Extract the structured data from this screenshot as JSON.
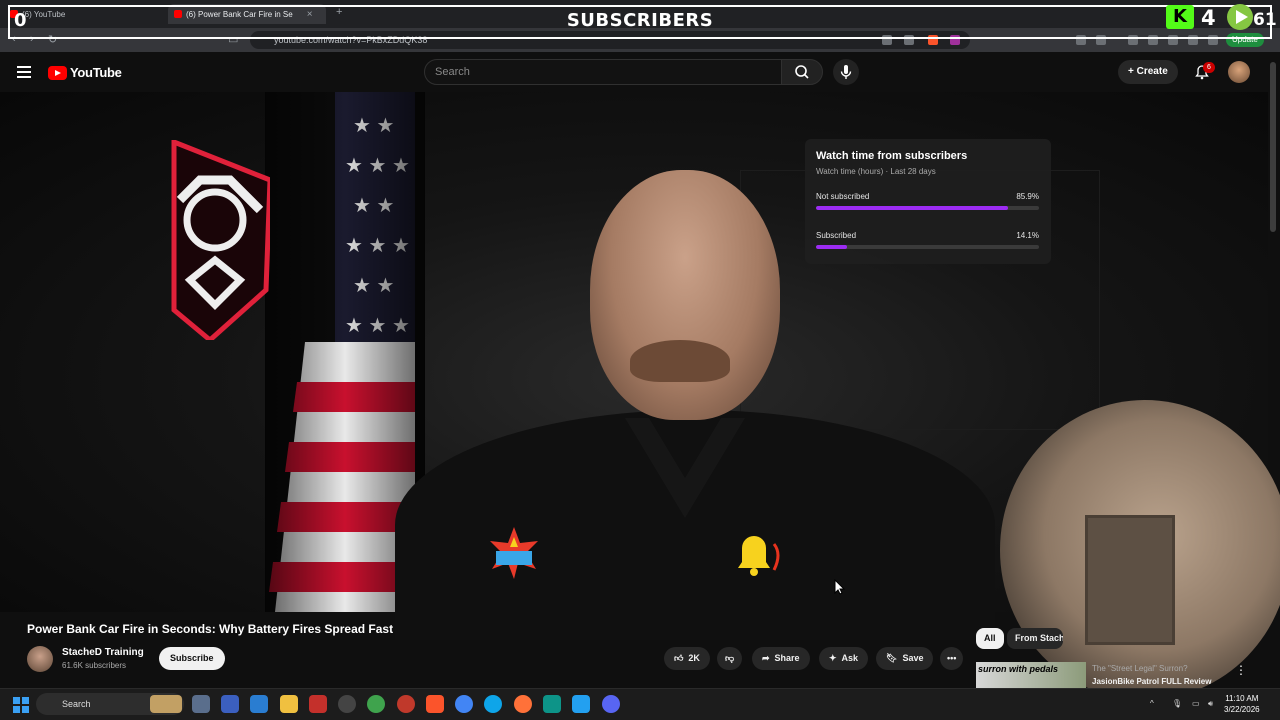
{
  "browser": {
    "tabs": [
      {
        "label": "(6) YouTube"
      },
      {
        "label": "(6) Power Bank Car Fire in Se"
      }
    ],
    "url": "youtube.com/watch?v=PkBxZDdQK38",
    "update_label": "Update"
  },
  "overlay": {
    "title": "SUBSCRIBERS",
    "left_count": "0",
    "kick_count": "4",
    "rumble_count": "61"
  },
  "header": {
    "logo_text": "YouTube",
    "search_placeholder": "Search",
    "create_label": "Create",
    "notification_count": "6"
  },
  "card": {
    "title": "Watch time from subscribers",
    "subtitle": "Watch time (hours) · Last 28 days",
    "metrics": [
      {
        "label": "Not subscribed",
        "value": "85.9%",
        "fraction": 0.859
      },
      {
        "label": "Subscribed",
        "value": "14.1%",
        "fraction": 0.141
      }
    ],
    "bar_color": "#9c2cf3"
  },
  "video": {
    "title": "Power Bank Car Fire in Seconds: Why Battery Fires Spread Fast",
    "channel_name": "StacheD Training",
    "channel_subs": "61.6K subscribers",
    "subscribe_label": "Subscribe",
    "like_count": "2K",
    "share_label": "Share",
    "ask_label": "Ask",
    "save_label": "Save"
  },
  "sidebar": {
    "chips": [
      "All",
      "From Stach"
    ],
    "rec": {
      "thumb_text": "surron with pedals",
      "title": "The \"Street Legal\" Surron?",
      "title2": "JasionBike Patrol FULL Review"
    }
  },
  "taskbar": {
    "search_label": "Search",
    "time": "11:10 AM",
    "date": "3/22/2026"
  }
}
